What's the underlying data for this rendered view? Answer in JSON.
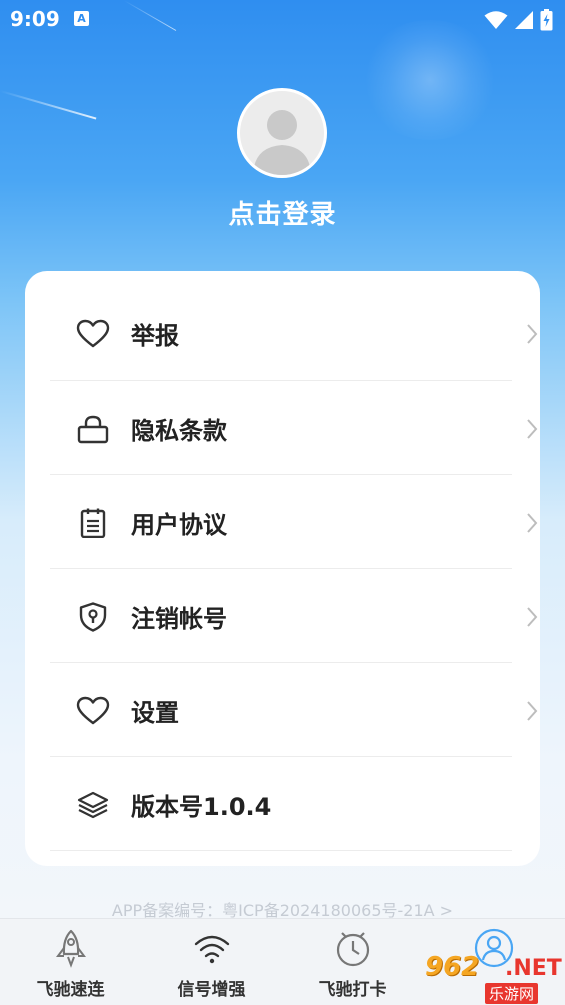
{
  "status_bar": {
    "time": "9:09",
    "notification_badge": "A",
    "icons": [
      "wifi-icon",
      "cellular-signal-icon",
      "battery-charging-icon"
    ]
  },
  "profile": {
    "avatar_icon": "default-avatar-icon",
    "login_text": "点击登录"
  },
  "menu": {
    "items": [
      {
        "label": "举报",
        "icon": "heart-icon",
        "has_chevron": true
      },
      {
        "label": "隐私条款",
        "icon": "lock-icon",
        "has_chevron": true
      },
      {
        "label": "用户协议",
        "icon": "notepad-icon",
        "has_chevron": true
      },
      {
        "label": "注销帐号",
        "icon": "shield-keyhole-icon",
        "has_chevron": true
      },
      {
        "label": "设置",
        "icon": "heart-icon",
        "has_chevron": true
      },
      {
        "label": "版本号1.0.4",
        "icon": "layers-icon",
        "has_chevron": false
      }
    ]
  },
  "footer": {
    "beian": "APP备案编号：粤ICP备2024180065号-21A >"
  },
  "bottom_nav": {
    "items": [
      {
        "label": "飞驰速连",
        "icon": "rocket-icon"
      },
      {
        "label": "信号增强",
        "icon": "wifi-signal-icon"
      },
      {
        "label": "飞驰打卡",
        "icon": "clock-icon"
      },
      {
        "label": "",
        "icon": "user-icon"
      }
    ]
  },
  "watermark": {
    "top": "962",
    "net": ".NET",
    "bottom": "乐游网"
  },
  "colors": {
    "accent": "#2f8ef0",
    "card_bg": "#ffffff",
    "text": "#222222"
  }
}
